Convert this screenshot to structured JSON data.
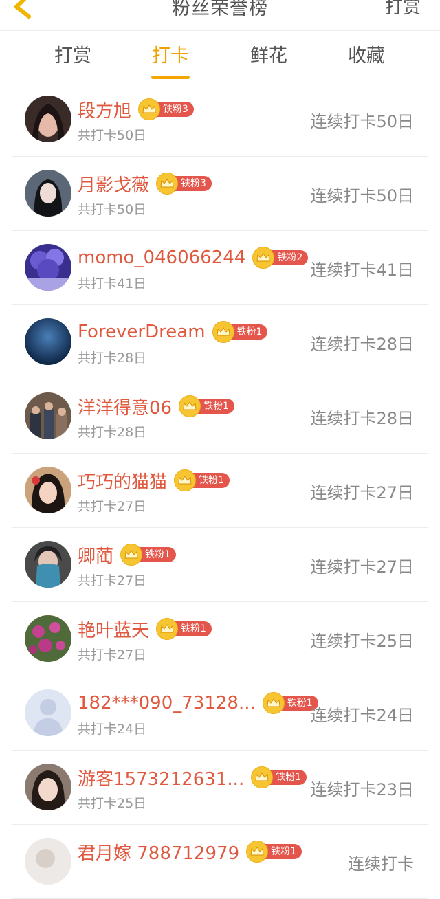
{
  "header": {
    "title": "粉丝荣誉榜",
    "right_action": "打赏"
  },
  "tabs": [
    {
      "label": "打赏",
      "active": false
    },
    {
      "label": "打卡",
      "active": true
    },
    {
      "label": "鲜花",
      "active": false
    },
    {
      "label": "收藏",
      "active": false
    }
  ],
  "colors": {
    "accent": "#f0a100",
    "name": "#e0583e",
    "badge": "#e4564c",
    "crown": "#f7c531"
  },
  "rows": [
    {
      "name": "段方旭",
      "badge": "铁粉3",
      "total": "共打卡50日",
      "streak": "连续打卡50日"
    },
    {
      "name": "月影戈薇",
      "badge": "铁粉3",
      "total": "共打卡50日",
      "streak": "连续打卡50日"
    },
    {
      "name": "momo_046066244",
      "badge": "铁粉2",
      "total": "共打卡41日",
      "streak": "连续打卡41日"
    },
    {
      "name": "ForeverDream",
      "badge": "铁粉1",
      "total": "共打卡28日",
      "streak": "连续打卡28日"
    },
    {
      "name": "洋洋得意06",
      "badge": "铁粉1",
      "total": "共打卡28日",
      "streak": "连续打卡28日"
    },
    {
      "name": "巧巧的猫猫",
      "badge": "铁粉1",
      "total": "共打卡27日",
      "streak": "连续打卡27日"
    },
    {
      "name": "卿蔺",
      "badge": "铁粉1",
      "total": "共打卡27日",
      "streak": "连续打卡27日"
    },
    {
      "name": "艳叶蓝天",
      "badge": "铁粉1",
      "total": "共打卡27日",
      "streak": "连续打卡25日"
    },
    {
      "name": "182***090_73128...",
      "badge": "铁粉1",
      "total": "共打卡24日",
      "streak": "连续打卡24日"
    },
    {
      "name": "游客1573212631...",
      "badge": "铁粉1",
      "total": "共打卡25日",
      "streak": "连续打卡23日"
    },
    {
      "name": "君月嫁 788712979",
      "badge": "铁粉1",
      "total": "",
      "streak": "连续打卡"
    }
  ]
}
